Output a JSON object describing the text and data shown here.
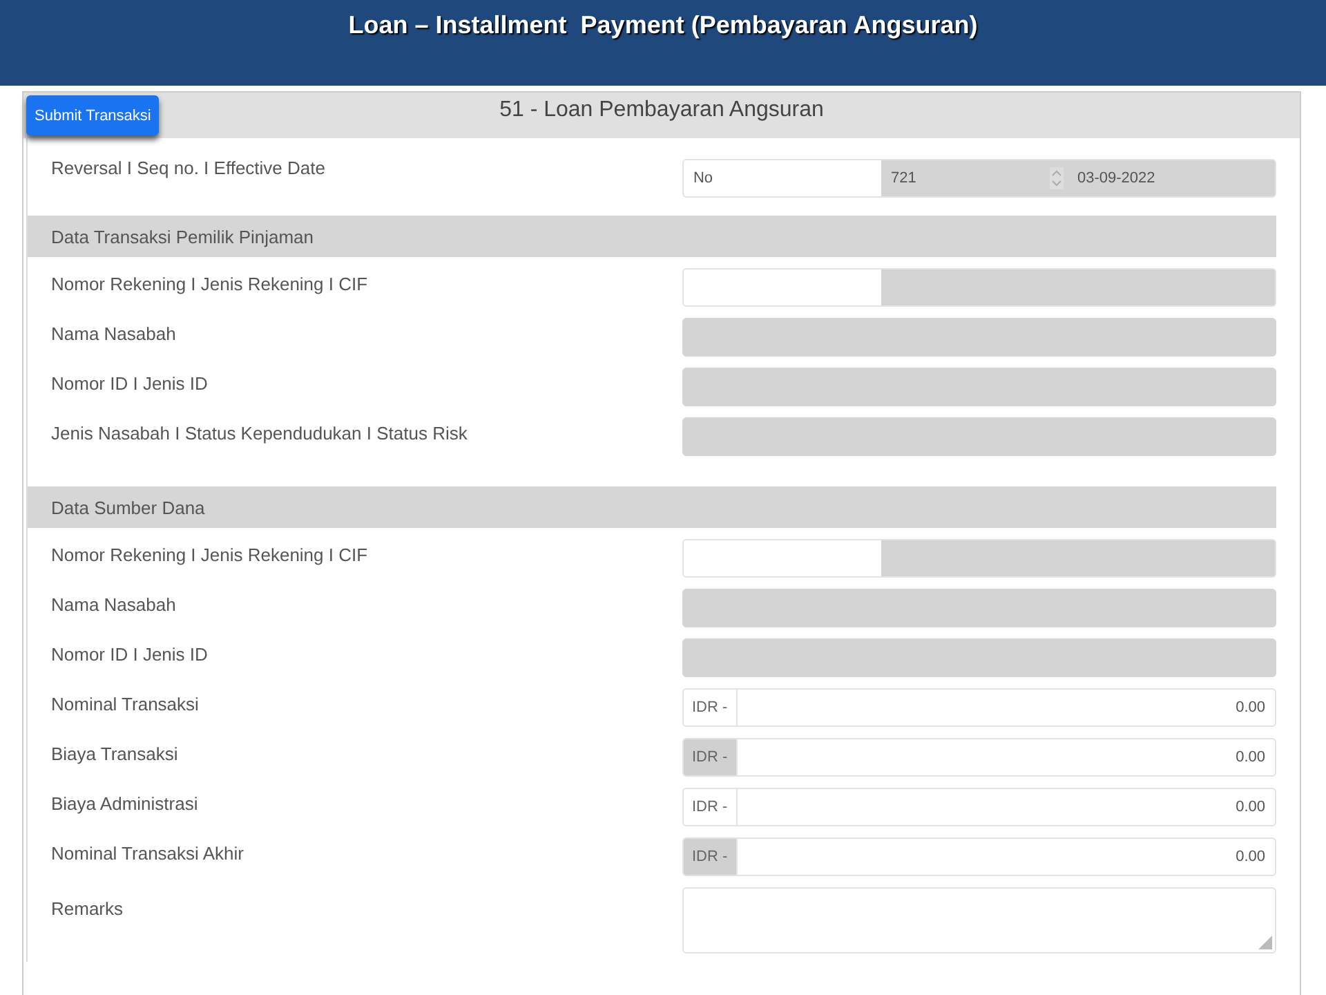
{
  "slide_title": "Loan – Installment  Payment (Pembayaran Angsuran)",
  "form": {
    "submit_button": "Submit Transaksi",
    "title": "51 - Loan Pembayaran Angsuran",
    "top_row": {
      "label": "Reversal I Seq no. I Effective Date",
      "reversal": "No",
      "seq_no": "721",
      "effective_date": "03-09-2022"
    },
    "sections": [
      {
        "title": "Data Transaksi Pemilik Pinjaman",
        "rows": [
          {
            "label": "Nomor Rekening I Jenis Rekening I CIF",
            "kind": "account"
          },
          {
            "label": "Nama Nasabah",
            "kind": "readonly"
          },
          {
            "label": "Nomor ID I Jenis ID",
            "kind": "readonly"
          },
          {
            "label": "Jenis Nasabah I Status Kependudukan I Status Risk",
            "kind": "readonly"
          }
        ]
      },
      {
        "title": "Data Sumber Dana",
        "rows": [
          {
            "label": "Nomor Rekening I Jenis Rekening I CIF",
            "kind": "account"
          },
          {
            "label": "Nama Nasabah",
            "kind": "readonly"
          },
          {
            "label": "Nomor ID I Jenis ID",
            "kind": "readonly"
          },
          {
            "label": "Nominal Transaksi",
            "kind": "currency",
            "prefix": "IDR -",
            "value": "0.00",
            "disabled": false
          },
          {
            "label": "Biaya Transaksi",
            "kind": "currency",
            "prefix": "IDR -",
            "value": "0.00",
            "disabled": true
          },
          {
            "label": "Biaya Administrasi",
            "kind": "currency",
            "prefix": "IDR -",
            "value": "0.00",
            "disabled": false
          },
          {
            "label": "Nominal Transaksi Akhir",
            "kind": "currency",
            "prefix": "IDR -",
            "value": "0.00",
            "disabled": true
          },
          {
            "label": "Remarks",
            "kind": "textarea"
          }
        ]
      }
    ]
  }
}
